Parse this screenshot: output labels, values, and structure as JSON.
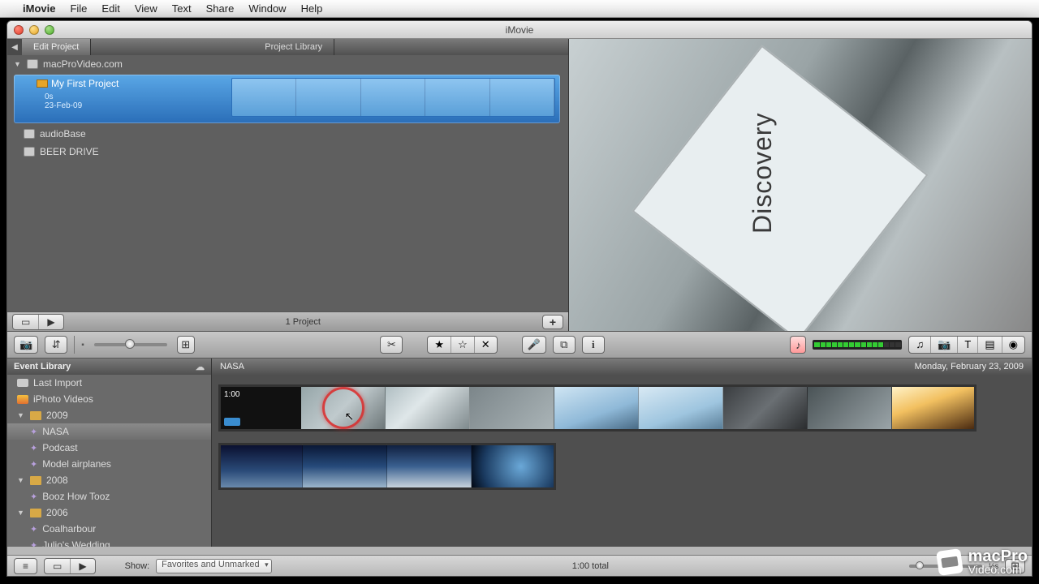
{
  "menubar": {
    "app": "iMovie",
    "items": [
      "File",
      "Edit",
      "View",
      "Text",
      "Share",
      "Window",
      "Help"
    ]
  },
  "window": {
    "title": "iMovie"
  },
  "projectArea": {
    "tabs": {
      "edit": "Edit Project",
      "library": "Project Library"
    },
    "drive": "macProVideo.com",
    "selected": {
      "name": "My First Project",
      "duration": "0s",
      "date": "23-Feb-09"
    },
    "otherDrives": [
      "audioBase",
      "BEER DRIVE"
    ],
    "count": "1 Project"
  },
  "viewer": {
    "overlay": "Discovery"
  },
  "midToolbar": {
    "icons": {
      "import": "camera-icon",
      "swap": "swap-icon",
      "frameview": "frameview-icon",
      "clipTrim": "clip-trim-icon",
      "favorite": "star-icon",
      "favoriteHalf": "star-outline-icon",
      "reject": "reject-icon",
      "voiceover": "microphone-icon",
      "crop": "crop-icon",
      "inspector": "info-icon",
      "audioSkim": "audio-skim-icon",
      "music": "music-icon",
      "photo": "photo-icon",
      "titles": "titles-icon",
      "transitions": "transitions-icon",
      "maps": "globe-icon"
    }
  },
  "eventSidebar": {
    "header": "Event Library",
    "items": [
      {
        "label": "Last Import",
        "level": 1,
        "icon": "cam"
      },
      {
        "label": "iPhoto Videos",
        "level": 1,
        "icon": "iphoto"
      },
      {
        "label": "2009",
        "level": 1,
        "icon": "folder",
        "disclose": "▼"
      },
      {
        "label": "NASA",
        "level": 2,
        "icon": "star",
        "selected": true
      },
      {
        "label": "Podcast",
        "level": 2,
        "icon": "star"
      },
      {
        "label": "Model airplanes",
        "level": 2,
        "icon": "star"
      },
      {
        "label": "2008",
        "level": 1,
        "icon": "folder",
        "disclose": "▼"
      },
      {
        "label": "Booz How Tooz",
        "level": 2,
        "icon": "star"
      },
      {
        "label": "2006",
        "level": 1,
        "icon": "folder",
        "disclose": "▼"
      },
      {
        "label": "Coalharbour",
        "level": 2,
        "icon": "star"
      },
      {
        "label": "Julio's Wedding",
        "level": 2,
        "icon": "star"
      }
    ]
  },
  "eventMain": {
    "title": "NASA",
    "date": "Monday, February 23, 2009",
    "clipLabel": "1:00"
  },
  "bottomBar": {
    "showLabel": "Show:",
    "filter": "Favorites and Unmarked",
    "total": "1:00 total"
  },
  "watermark": {
    "line1": "macPro",
    "line2": "Video.com"
  }
}
